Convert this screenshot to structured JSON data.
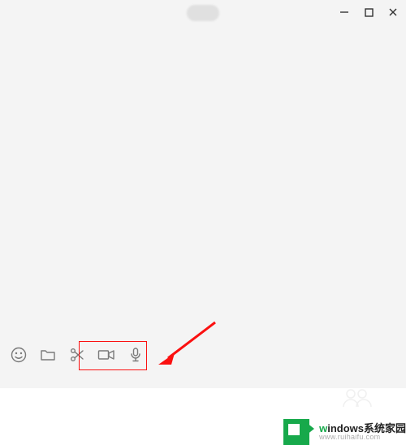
{
  "window": {
    "title": ""
  },
  "toolbar": {
    "emoji_label": "表情",
    "file_label": "发送文件",
    "screenshot_label": "截图",
    "video_label": "视频通话",
    "voice_label": "语音输入"
  },
  "window_controls": {
    "minimize": "最小化",
    "maximize": "最大化",
    "close": "关闭"
  },
  "watermark": {
    "brand_green": "w",
    "brand_rest": "indows系统家园",
    "url": "www.ruihaifu.com"
  },
  "annotation": {
    "arrow_color": "#fb1010",
    "highlight_color": "#fb1010"
  }
}
